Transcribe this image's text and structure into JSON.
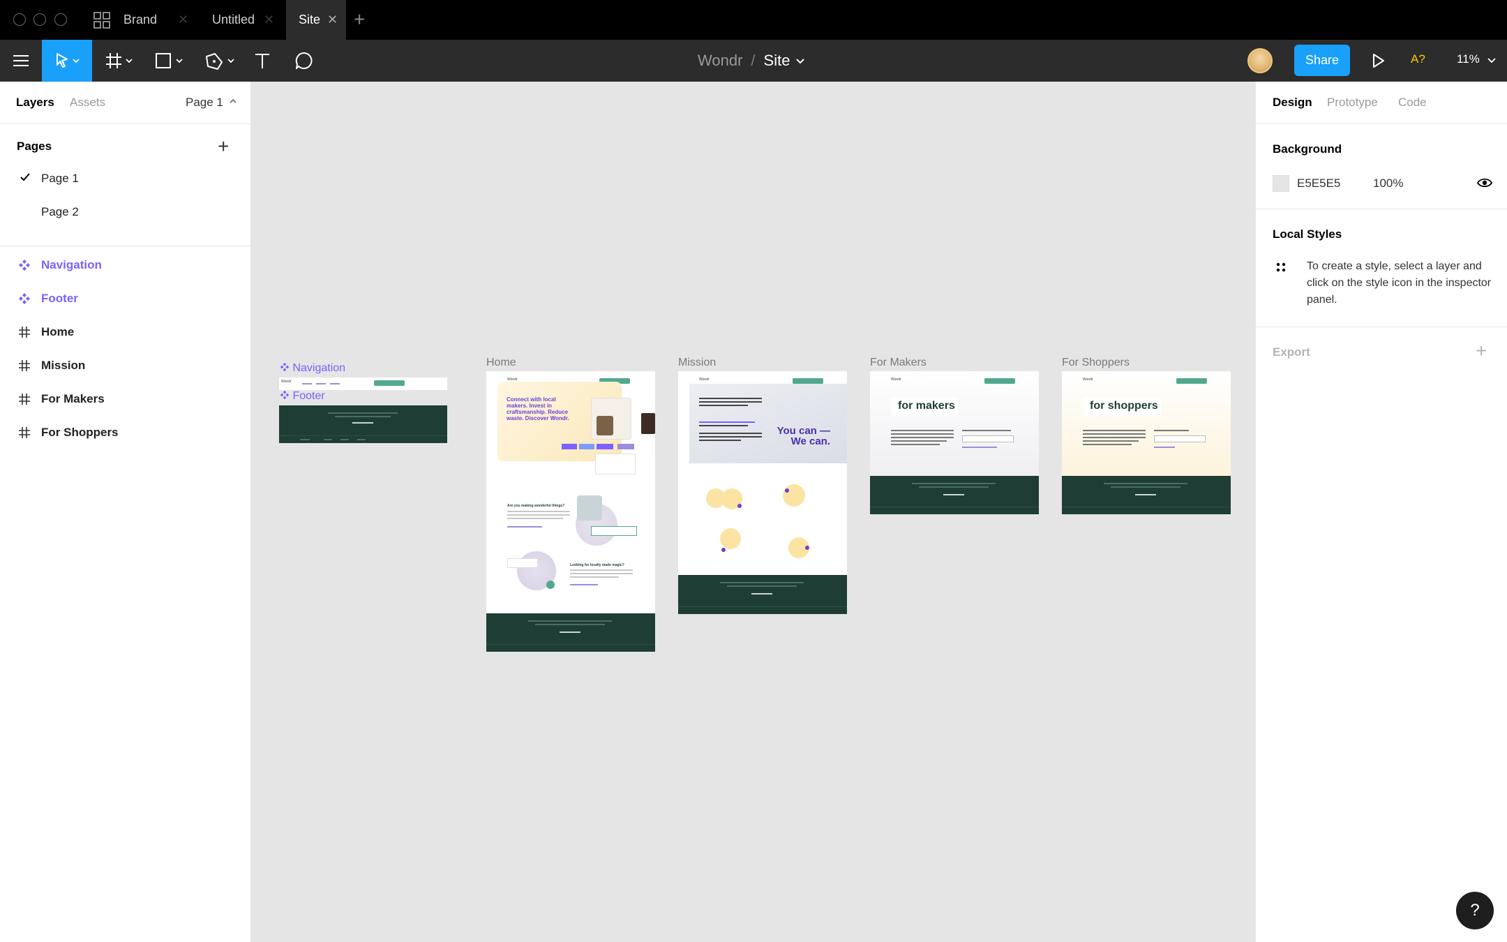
{
  "titlebar": {
    "tabs": [
      {
        "label": "Brand"
      },
      {
        "label": "Untitled"
      },
      {
        "label": "Site"
      }
    ],
    "close_glyph": "✕",
    "add_glyph": "+"
  },
  "toolbar": {
    "breadcrumb": {
      "team": "Wondr",
      "separator": "/",
      "file": "Site"
    },
    "share_label": "Share",
    "font_warning": "A?",
    "zoom": "11%"
  },
  "left_panel": {
    "tabs": {
      "layers": "Layers",
      "assets": "Assets",
      "page_select": "Page 1"
    },
    "pages_title": "Pages",
    "add_page": "+",
    "pages": [
      {
        "label": "Page 1",
        "selected": true
      },
      {
        "label": "Page 2",
        "selected": false
      }
    ],
    "layers": [
      {
        "label": "Navigation",
        "type": "component"
      },
      {
        "label": "Footer",
        "type": "component"
      },
      {
        "label": "Home",
        "type": "frame"
      },
      {
        "label": "Mission",
        "type": "frame"
      },
      {
        "label": "For Makers",
        "type": "frame"
      },
      {
        "label": "For Shoppers",
        "type": "frame"
      }
    ]
  },
  "canvas": {
    "background": "#E5E5E5",
    "components": {
      "navigation": "Navigation",
      "footer": "Footer"
    },
    "frames": {
      "home": "Home",
      "mission": "Mission",
      "makers": "For Makers",
      "shoppers": "For Shoppers"
    },
    "home_hero": "Connect with local makers. Invest in craftsmanship. Reduce waste. Discover Wondr.",
    "home_q1": "Are you making wonderful things?",
    "home_q2": "Looking for locally made magic?",
    "mission_hero": "You can — We can.",
    "makers_title": "for makers",
    "shoppers_title": "for shoppers",
    "logo": "Wondr"
  },
  "right_panel": {
    "tabs": {
      "design": "Design",
      "prototype": "Prototype",
      "code": "Code"
    },
    "background_title": "Background",
    "background_hex": "E5E5E5",
    "background_opacity": "100%",
    "local_styles_title": "Local Styles",
    "local_styles_help": "To create a style, select a layer and click on the style icon in the inspector panel.",
    "export_title": "Export",
    "export_add": "+"
  },
  "help_button": "?",
  "colors": {
    "accent": "#18A0FB",
    "component": "#7B61FF",
    "brand_dark": "#1E3D35",
    "brand_purple": "#6B3FD6",
    "warning": "#FFC700"
  }
}
